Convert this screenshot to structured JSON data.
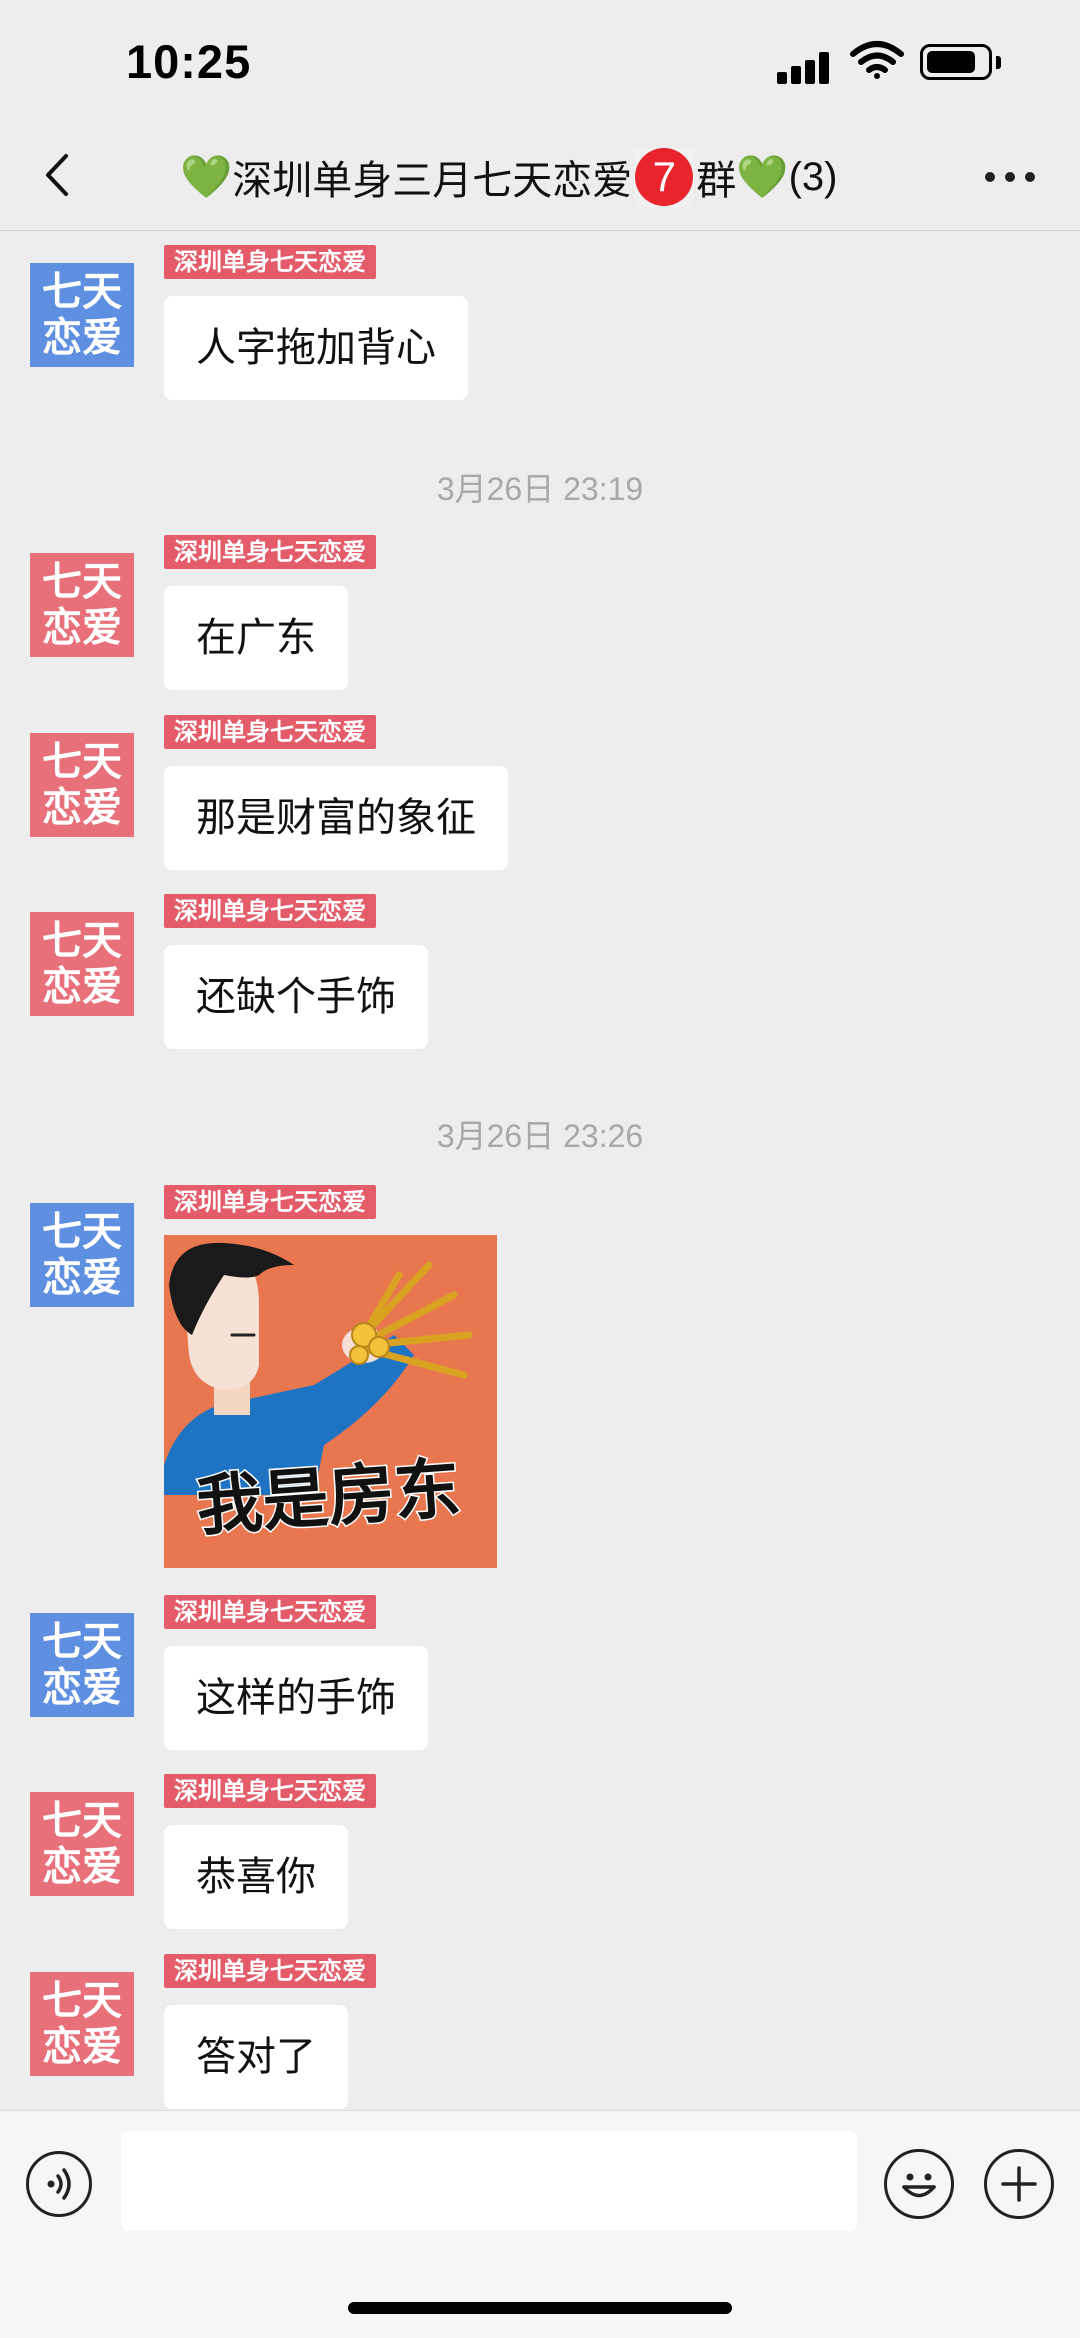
{
  "status_bar": {
    "time": "10:25"
  },
  "header": {
    "title_prefix": "深圳单身三月七天恋爱",
    "title_badge": "7",
    "title_suffix": "群",
    "member_count": "(3)",
    "heart_glyph": "💚"
  },
  "messages": [
    {
      "sender": "深圳单身七天恋爱",
      "avatar_line1": "七天",
      "avatar_line2": "恋爱",
      "avatar_color": "blue",
      "text": "人字拖加背心"
    },
    {
      "sender": "深圳单身七天恋爱",
      "avatar_line1": "七天",
      "avatar_line2": "恋爱",
      "avatar_color": "pink",
      "text": "在广东"
    },
    {
      "sender": "深圳单身七天恋爱",
      "avatar_line1": "七天",
      "avatar_line2": "恋爱",
      "avatar_color": "pink",
      "text": "那是财富的象征"
    },
    {
      "sender": "深圳单身七天恋爱",
      "avatar_line1": "七天",
      "avatar_line2": "恋爱",
      "avatar_color": "pink",
      "text": "还缺个手饰"
    },
    {
      "sender": "深圳单身七天恋爱",
      "avatar_line1": "七天",
      "avatar_line2": "恋爱",
      "avatar_color": "blue",
      "sticker_text": "我是房东"
    },
    {
      "sender": "深圳单身七天恋爱",
      "avatar_line1": "七天",
      "avatar_line2": "恋爱",
      "avatar_color": "blue",
      "text": "这样的手饰"
    },
    {
      "sender": "深圳单身七天恋爱",
      "avatar_line1": "七天",
      "avatar_line2": "恋爱",
      "avatar_color": "pink",
      "text": "恭喜你"
    },
    {
      "sender": "深圳单身七天恋爱",
      "avatar_line1": "七天",
      "avatar_line2": "恋爱",
      "avatar_color": "pink",
      "text": "答对了"
    }
  ],
  "timestamps": [
    "3月26日 23:19",
    "3月26日 23:26"
  ],
  "input": {
    "value": "",
    "placeholder": ""
  },
  "colors": {
    "background": "#ededed",
    "sender_tag": "#e45c6a",
    "avatar_blue": "#5f8fe0",
    "avatar_pink": "#e8707a"
  }
}
